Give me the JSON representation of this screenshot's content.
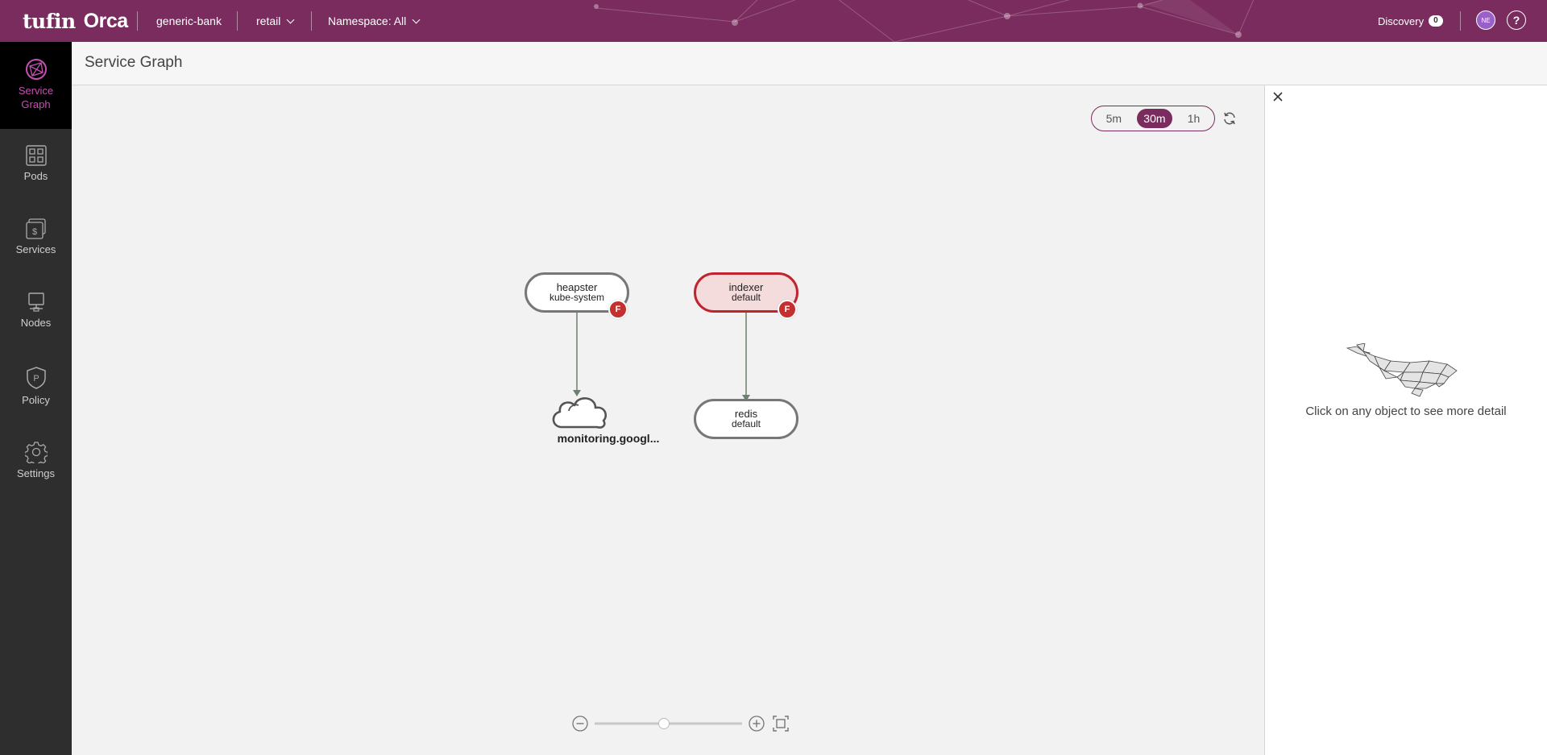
{
  "app": {
    "logo_tufin": "tufin",
    "logo_orca": "Orca",
    "account": "generic-bank",
    "cluster": "retail",
    "namespace": "Namespace: All",
    "discovery_label": "Discovery",
    "discovery_count": "0",
    "user_initials": "NE",
    "help_label": "?",
    "brand_color": "#7a2c5e",
    "accent_color": "#c64fb2"
  },
  "sidebar": {
    "items": [
      {
        "label_line1": "Service",
        "label_line2": "Graph",
        "icon": "service-graph-icon",
        "active": true
      },
      {
        "label": "Pods",
        "icon": "pods-grid-icon"
      },
      {
        "label": "Services",
        "icon": "services-icon"
      },
      {
        "label": "Nodes",
        "icon": "nodes-monitor-icon"
      },
      {
        "label": "Policy",
        "icon": "policy-shield-icon"
      },
      {
        "label": "Settings",
        "icon": "gear-icon"
      }
    ]
  },
  "page": {
    "title": "Service Graph"
  },
  "time_range": {
    "options": [
      "5m",
      "30m",
      "1h"
    ],
    "selected": "30m"
  },
  "graph": {
    "nodes": [
      {
        "name": "heapster",
        "namespace": "kube-system",
        "status": "error",
        "badge": "F",
        "status_color": "#777777"
      },
      {
        "name": "indexer",
        "namespace": "default",
        "status": "error",
        "badge": "F",
        "status_color": "#c0242f"
      },
      {
        "name": "monitoring.googl...",
        "type": "external-cloud"
      },
      {
        "name": "redis",
        "namespace": "default",
        "type": "service"
      }
    ],
    "edges": [
      {
        "from": "heapster",
        "to": "monitoring.googl..."
      },
      {
        "from": "indexer",
        "to": "redis"
      }
    ],
    "zoom_level": 0.47
  },
  "detail_panel": {
    "hint": "Click on any object to see more detail"
  }
}
